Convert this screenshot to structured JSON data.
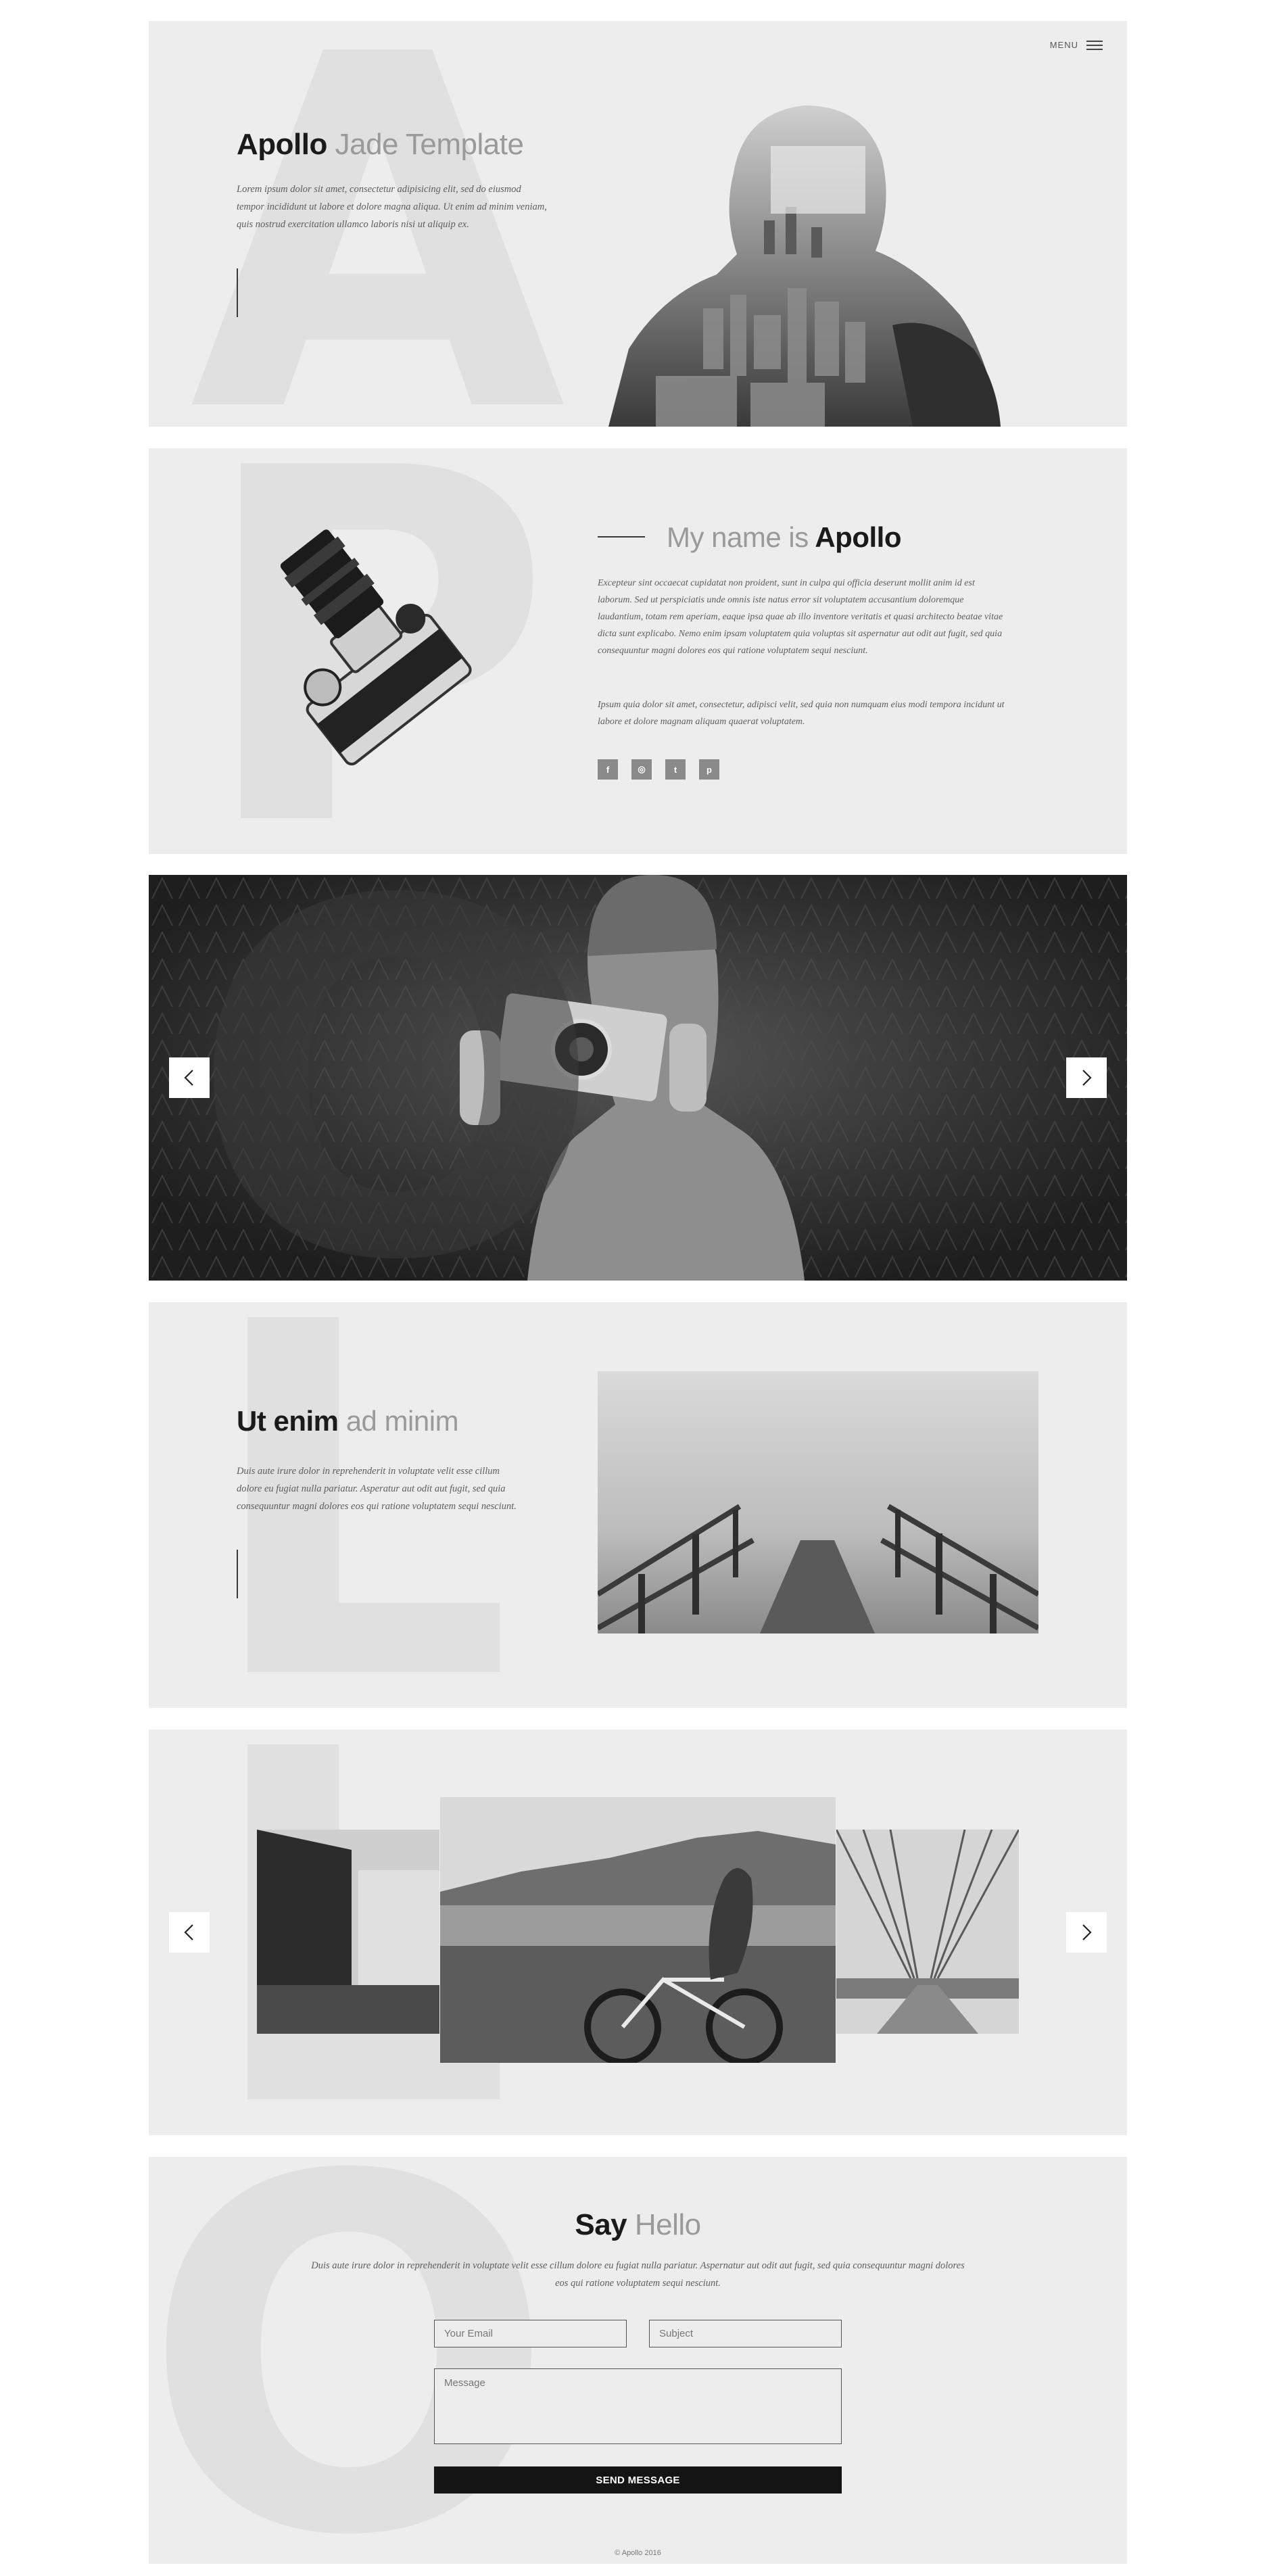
{
  "nav": {
    "menu_label": "MENU"
  },
  "hero": {
    "letter": "A",
    "title_bold": "Apollo",
    "title_light": "Jade Template",
    "text": "Lorem ipsum dolor sit amet, consectetur adipisicing elit, sed do eiusmod tempor incididunt ut labore et dolore magna aliqua. Ut enim ad minim veniam, quis nostrud exercitation ullamco laboris nisi ut aliquip ex."
  },
  "about": {
    "letter": "P",
    "title_light": "My name is",
    "title_bold": "Apollo",
    "text1": "Excepteur sint occaecat cupidatat non proident, sunt in culpa qui officia deserunt mollit anim id est laborum. Sed ut perspiciatis unde omnis iste natus error sit voluptatem accusantium doloremque laudantium, totam rem aperiam, eaque ipsa quae ab illo inventore veritatis et quasi architecto beatae vitae dicta sunt explicabo. Nemo enim ipsam voluptatem quia voluptas sit aspernatur aut odit aut fugit, sed quia consequuntur magni dolores eos qui ratione voluptatem sequi nesciunt.",
    "text2": "Ipsum quia dolor sit amet, consectetur, adipisci velit, sed quia non numquam eius modi tempora incidunt ut labore et dolore magnam aliquam quaerat voluptatem.",
    "social": [
      "f",
      "◎",
      "t",
      "p"
    ]
  },
  "slider": {
    "letter": "O",
    "prev": "‹",
    "next": "›"
  },
  "feature": {
    "letter": "L",
    "title_bold": "Ut enim",
    "title_light": "ad minim",
    "text": "Duis aute irure dolor in reprehenderit in voluptate velit esse cillum dolore eu fugiat nulla pariatur. Asperatur aut odit aut fugit, sed quia consequuntur magni dolores eos qui ratione voluptatem sequi nesciunt."
  },
  "carousel": {
    "letter": "L",
    "prev": "‹",
    "next": "›"
  },
  "contact": {
    "letter": "O",
    "title_bold": "Say",
    "title_light": "Hello",
    "text": "Duis aute irure dolor in reprehenderit in voluptate velit esse cillum dolore eu fugiat nulla pariatur. Aspernatur aut odit aut fugit, sed quia consequuntur magni dolores eos qui ratione voluptatem sequi nesciunt.",
    "email_placeholder": "Your Email",
    "subject_placeholder": "Subject",
    "message_placeholder": "Message",
    "send_label": "SEND MESSAGE",
    "copyright": "© Apollo 2016"
  }
}
